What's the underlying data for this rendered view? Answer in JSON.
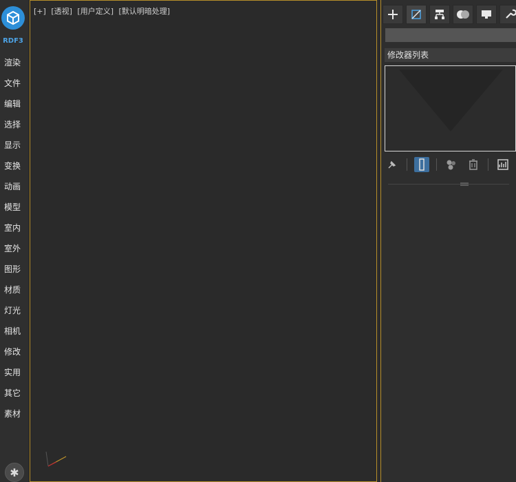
{
  "sidebar": {
    "brand": "RDF3",
    "items": [
      "渲染",
      "文件",
      "编辑",
      "选择",
      "显示",
      "变换",
      "动画",
      "模型",
      "室内",
      "室外",
      "图形",
      "材质",
      "灯光",
      "相机",
      "修改",
      "实用",
      "其它",
      "素材"
    ],
    "settings_icon": "gear-icon"
  },
  "viewport": {
    "labels": [
      "[+]",
      "[透视]",
      "[用户定义]",
      "[默认明暗处理]"
    ]
  },
  "command_panel": {
    "tabs": [
      "create-icon",
      "modify-icon",
      "hierarchy-icon",
      "motion-icon",
      "display-icon",
      "utilities-icon"
    ],
    "name_value": "",
    "modifier_list": "修改器列表"
  },
  "colors": {
    "accent": "#b8902a",
    "logo": "#2d8fd8",
    "brand_text": "#4da3e6",
    "active_tool": "#3d6f9e"
  }
}
